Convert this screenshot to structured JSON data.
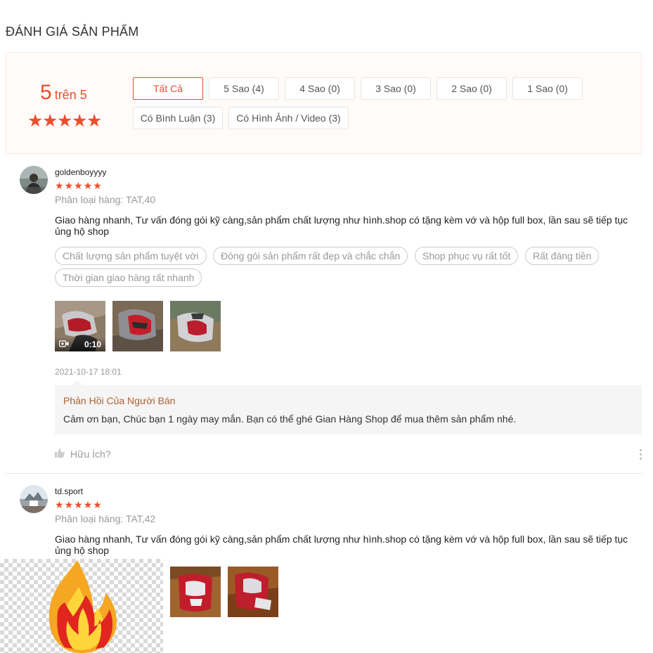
{
  "section_title": "ĐÁNH GIÁ SẢN PHẨM",
  "overview": {
    "score": "5",
    "score_suffix": "trên 5",
    "star_count": 5,
    "filters": [
      "Tất Cả",
      "5 Sao (4)",
      "4 Sao (0)",
      "3 Sao (0)",
      "2 Sao (0)",
      "1 Sao (0)",
      "Có Bình Luận (3)",
      "Có Hình Ảnh / Video (3)"
    ],
    "active_filter": "Tất Cả"
  },
  "reviews": [
    {
      "username": "goldenboyyyy",
      "rating": 5,
      "variation": "Phân loại hàng: TAT,40",
      "comment": "Giao hàng nhanh, Tư vấn đóng gói kỹ càng,sản phẩm chất lượng như hình.shop có tặng kèm vớ và hộp full box, lần sau sẽ tiếp tục ủng hộ shop",
      "tags": [
        "Chất lượng sản phẩm tuyệt vời",
        "Đóng gói sản phẩm rất đẹp và chắc chắn",
        "Shop phục vụ rất tốt",
        "Rất đáng tiền",
        "Thời gian giao hàng rất nhanh"
      ],
      "video_duration": "0:10",
      "timestamp": "2021-10-17 18:01",
      "seller_reply_title": "Phản Hồi Của Người Bán",
      "seller_reply": "Cảm ơn bạn, Chúc bạn 1 ngày may mắn. Bạn có thể ghé Gian Hàng Shop để mua thêm sản phẩm nhé.",
      "helpful_label": "Hữu Ích?"
    },
    {
      "username": "td.sport",
      "rating": 5,
      "variation": "Phân loại hàng: TAT,42",
      "comment": "Giao hàng nhanh, Tư vấn đóng gói kỹ càng,sản phẩm chất lượng như hình.shop có tặng kèm vớ và hộp full box, lần sau sẽ tiếp tục ủng hộ shop"
    }
  ],
  "colors": {
    "accent": "#ee4d2d",
    "overview_bg": "#fffbf8",
    "reply_bg": "#f5f5f5"
  }
}
